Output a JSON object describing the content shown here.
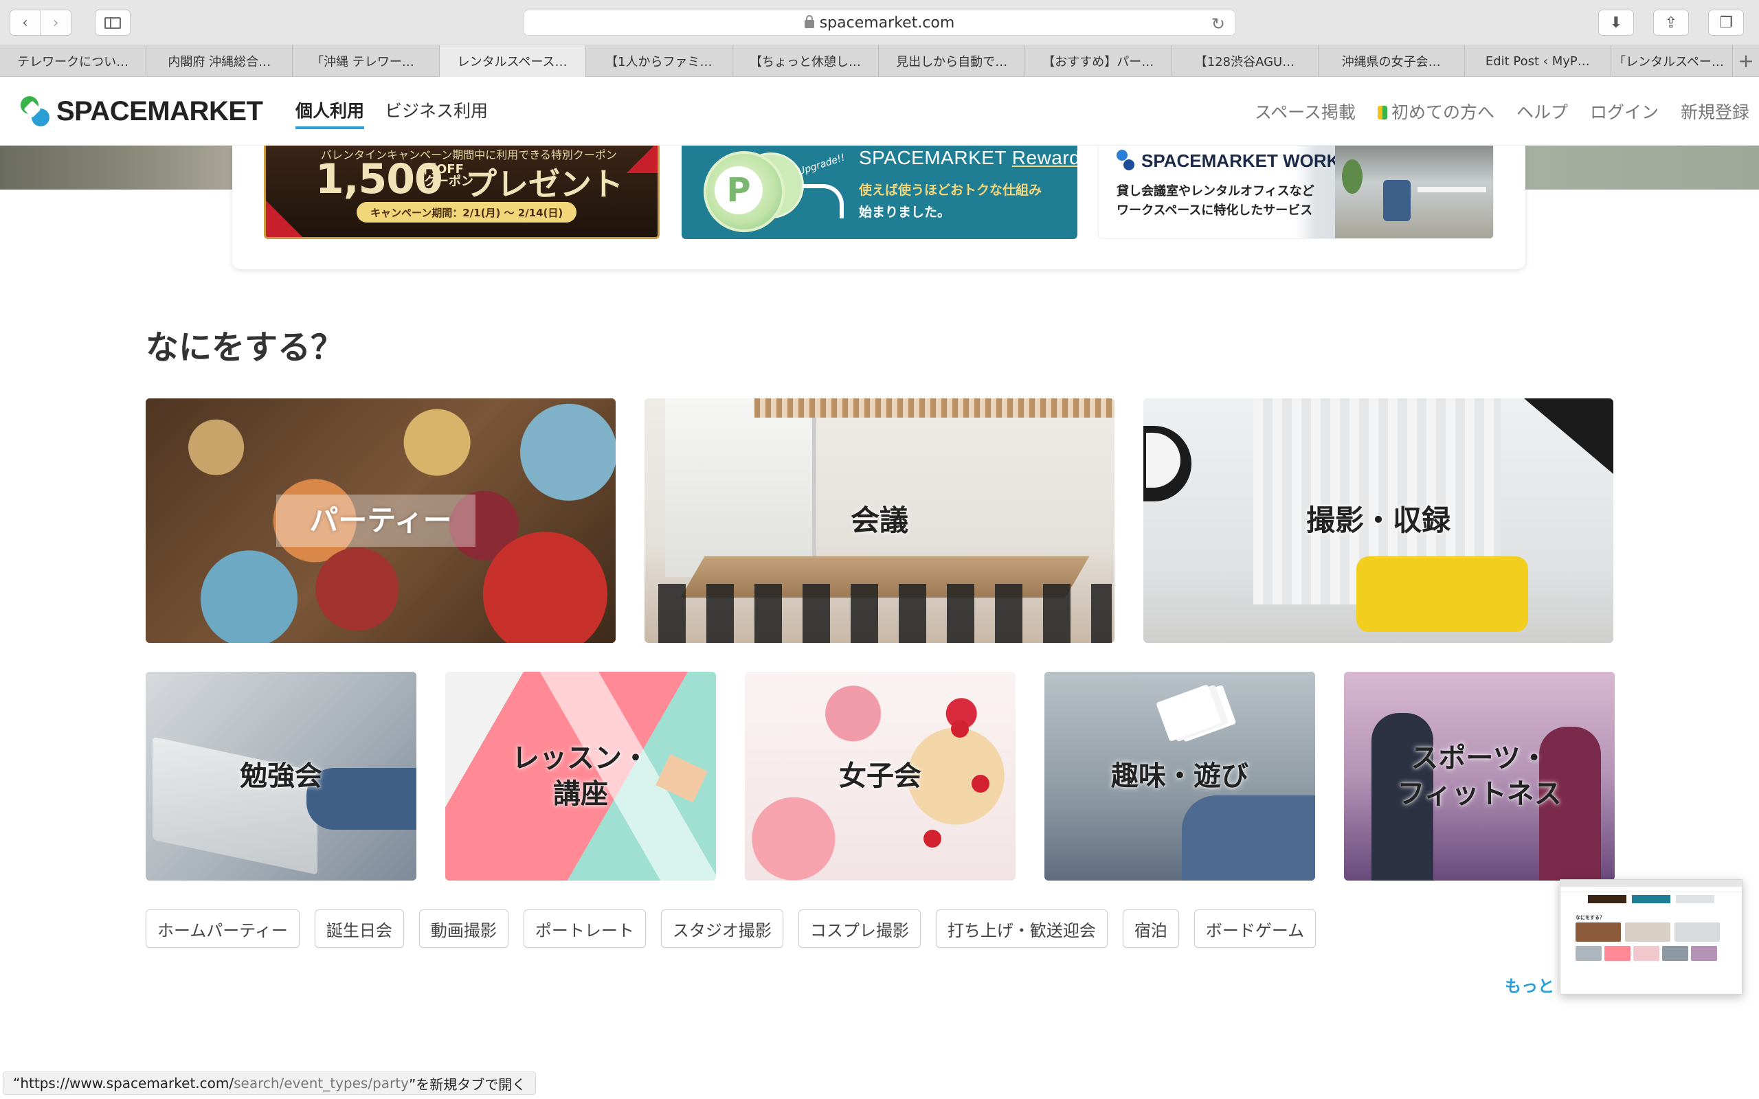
{
  "browser": {
    "url": "spacemarket.com",
    "tabs": [
      {
        "label": "テレワークについ…",
        "active": false
      },
      {
        "label": "内閣府 沖縄総合…",
        "active": false
      },
      {
        "label": "｢沖縄 テレワー…",
        "active": false
      },
      {
        "label": "レンタルスペース…",
        "active": true
      },
      {
        "label": "【1人からファミ…",
        "active": false
      },
      {
        "label": "【ちょっと休憩し…",
        "active": false
      },
      {
        "label": "見出しから自動で…",
        "active": false
      },
      {
        "label": "【おすすめ】パー…",
        "active": false
      },
      {
        "label": "【128渋谷AGU…",
        "active": false
      },
      {
        "label": "沖縄県の女子会…",
        "active": false
      },
      {
        "label": "Edit Post ‹ MyP…",
        "active": false
      },
      {
        "label": "｢レンタルスペー…",
        "active": false
      }
    ],
    "status_url_main": "“https://www.spacemarket.com/",
    "status_url_path": "search/event_types/party",
    "status_suffix": "”を新規タブで開く"
  },
  "header": {
    "logo_text": "SPACEMARKET",
    "nav": [
      {
        "label": "個人利用",
        "active": true
      },
      {
        "label": "ビジネス利用",
        "active": false
      }
    ],
    "right_nav": {
      "list_space": "スペース掲載",
      "first_time": "初めての方へ",
      "help": "ヘルプ",
      "login": "ログイン",
      "signup": "新規登録"
    }
  },
  "banners": {
    "coupon": {
      "top_text": "バレンタインキャンペーン期間中に利用できる特別クーポン",
      "amount": "1,500",
      "unit_top": "円OFF",
      "unit_bottom": "クーポン",
      "present": "プレゼント",
      "period": "キャンペーン期間：2/1(月) 〜 2/14(日)"
    },
    "rewards": {
      "coin_letter": "P",
      "upgrade": "Upgrade!!",
      "title_main": "SPACEMARKET ",
      "title_accent": "Rewards",
      "line1": "使えば使うほどおトクな仕組み",
      "line2": "始まりました。"
    },
    "work": {
      "title": "SPACEMARKET WORK",
      "line1": "貸し会議室やレンタルオフィスなど",
      "line2": "ワークスペースに特化したサービス"
    }
  },
  "section": {
    "title": "なにをする？",
    "big_categories": [
      {
        "label": "パーティー"
      },
      {
        "label": "会議"
      },
      {
        "label": "撮影・収録"
      }
    ],
    "small_categories": [
      {
        "label": "勉強会"
      },
      {
        "label": "レッスン・\n講座"
      },
      {
        "label": "女子会"
      },
      {
        "label": "趣味・遊び"
      },
      {
        "label": "スポーツ・\nフィットネス"
      }
    ],
    "tags": [
      "ホームパーティー",
      "誕生日会",
      "動画撮影",
      "ポートレート",
      "スタジオ撮影",
      "コスプレ撮影",
      "打ち上げ・歓送迎会",
      "宿泊",
      "ボードゲーム"
    ],
    "more": "もっと"
  },
  "thumbnail": {
    "title": "なにをする？"
  },
  "colors": {
    "accent_blue": "#2a9fd6",
    "brand_green": "#37b34a"
  }
}
